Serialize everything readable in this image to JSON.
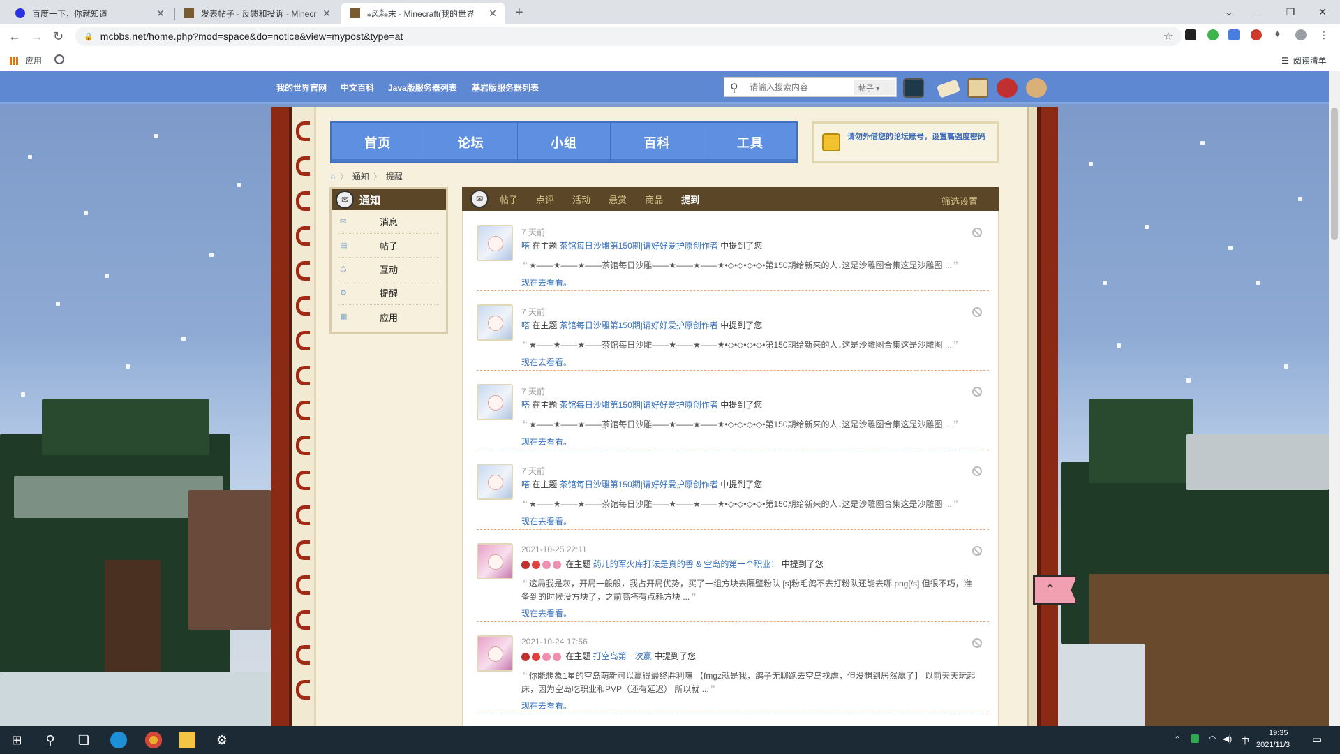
{
  "browser": {
    "tabs": [
      {
        "title": "百度一下，你就知道",
        "active": false
      },
      {
        "title": "发表帖子 - 反馈和投诉 - Minecr",
        "active": false
      },
      {
        "title": "⁎风⁑⁎末 - Minecraft(我的世界",
        "active": true
      }
    ],
    "url": "mcbbs.net/home.php?mod=space&do=notice&view=mypost&type=at",
    "bookmarks": {
      "apps": "应用",
      "reading_list": "阅读清单"
    }
  },
  "site": {
    "top_links": [
      "我的世界官网",
      "中文百科",
      "Java版服务器列表",
      "基岩版服务器列表"
    ],
    "search": {
      "placeholder": "请输入搜索内容",
      "scope": "帖子"
    },
    "main_nav": [
      "首页",
      "论坛",
      "小组",
      "百科",
      "工具"
    ],
    "notice": "请勿外借您的论坛账号，设置高强度密码",
    "breadcrumb": [
      "通知",
      "提醒"
    ]
  },
  "sidebar": {
    "title": "通知",
    "items": [
      {
        "label": "消息",
        "icon": "envelope-icon"
      },
      {
        "label": "帖子",
        "icon": "document-icon"
      },
      {
        "label": "互动",
        "icon": "recycle-icon"
      },
      {
        "label": "提醒",
        "icon": "gear-icon"
      },
      {
        "label": "应用",
        "icon": "grid-icon"
      }
    ]
  },
  "content_tabs": {
    "items": [
      "帖子",
      "点评",
      "活动",
      "悬赏",
      "商品",
      "提到"
    ],
    "active": "提到",
    "filter": "筛选设置"
  },
  "notifications": [
    {
      "time": "7 天前",
      "user": "嗒",
      "pre": "在主题",
      "topic": "茶馆每日沙雕第150期|请好好爱护原创作者",
      "post": "中提到了您",
      "quote": "★——★——★——茶馆每日沙雕——★——★——★•◇•◇•◇•◇•第150期给新来的人↓这是沙雕图合集这是沙雕图 ...",
      "go": "现在去看看。"
    },
    {
      "time": "7 天前",
      "user": "嗒",
      "pre": "在主题",
      "topic": "茶馆每日沙雕第150期|请好好爱护原创作者",
      "post": "中提到了您",
      "quote": "★——★——★——茶馆每日沙雕——★——★——★•◇•◇•◇•◇•第150期给新来的人↓这是沙雕图合集这是沙雕图 ...",
      "go": "现在去看看。"
    },
    {
      "time": "7 天前",
      "user": "嗒",
      "pre": "在主题",
      "topic": "茶馆每日沙雕第150期|请好好爱护原创作者",
      "post": "中提到了您",
      "quote": "★——★——★——茶馆每日沙雕——★——★——★•◇•◇•◇•◇•第150期给新来的人↓这是沙雕图合集这是沙雕图 ...",
      "go": "现在去看看。"
    },
    {
      "time": "7 天前",
      "user": "嗒",
      "pre": "在主题",
      "topic": "茶馆每日沙雕第150期|请好好爱护原创作者",
      "post": "中提到了您",
      "quote": "★——★——★——茶馆每日沙雕——★——★——★•◇•◇•◇•◇•第150期给新来的人↓这是沙雕图合集这是沙雕图 ...",
      "go": "现在去看看。"
    },
    {
      "time": "2021-10-25 22:11",
      "user": "",
      "pre": "在主题",
      "topic": "药儿的军火库打法是真的香 & 空岛的第一个职业！",
      "post": "中提到了您",
      "quote": "这局我是灰，开局一般般，我占开局优势，买了一组方块去隔壁粉队 [s]粉毛鸽不去打粉队还能去哪.png[/s] 但很不巧，准备到的时候没方块了，之前高搭有点耗方块 ...",
      "go": "现在去看看。"
    },
    {
      "time": "2021-10-24 17:56",
      "user": "",
      "pre": "在主题",
      "topic": "打空岛第一次赢",
      "post": "中提到了您",
      "quote": "你能想象1星的空岛萌新可以赢得最终胜利嘛 【fmgz就是我，鸽子无聊跑去空岛找虐，但没想到居然赢了】 以前天天玩起床，因为空岛吃职业和PVP（还有延迟） 所以就 ...",
      "go": "现在去看看。"
    }
  ],
  "taskbar": {
    "ime": "中",
    "time": "19:35",
    "date": "2021/11/3"
  }
}
